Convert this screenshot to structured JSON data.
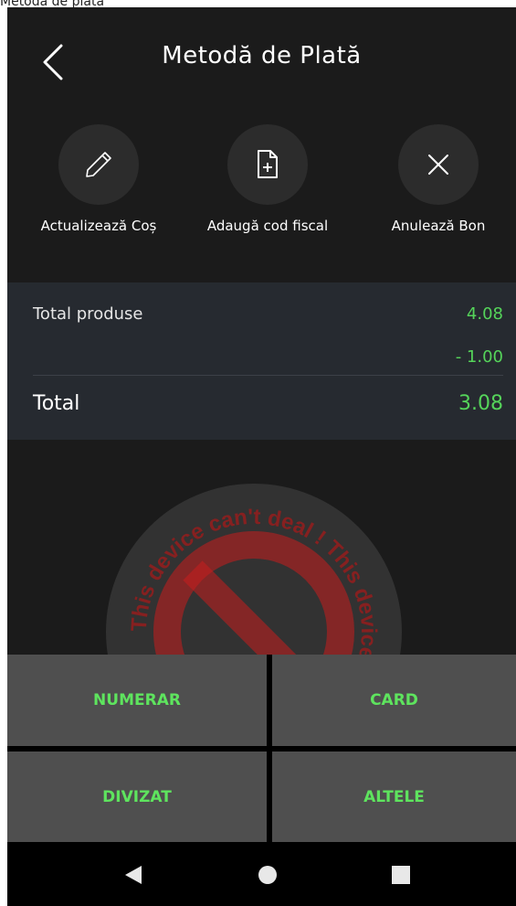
{
  "window": {
    "title": "Metodă de plată"
  },
  "header": {
    "title": "Metodă de Plată",
    "back_icon": "chevron-left-icon"
  },
  "actions": [
    {
      "label": "Actualizează Coș",
      "icon": "pencil-icon"
    },
    {
      "label": "Adaugă cod fiscal",
      "icon": "file-plus-icon"
    },
    {
      "label": "Anulează Bon",
      "icon": "close-icon"
    }
  ],
  "summary": {
    "total_produse_label": "Total produse",
    "total_produse_value": "4.08",
    "discount_value": "- 1.00",
    "total_label": "Total",
    "total_value": "3.08"
  },
  "watermark": {
    "text": "This device can't deal ! This device can't deal !"
  },
  "payment": {
    "numerar": "NUMERAR",
    "card": "CARD",
    "divizat": "DIVIZAT",
    "altele": "ALTELE"
  },
  "colors": {
    "accent_green": "#55d45a",
    "background": "#1b1b1b",
    "panel": "#262a30"
  }
}
